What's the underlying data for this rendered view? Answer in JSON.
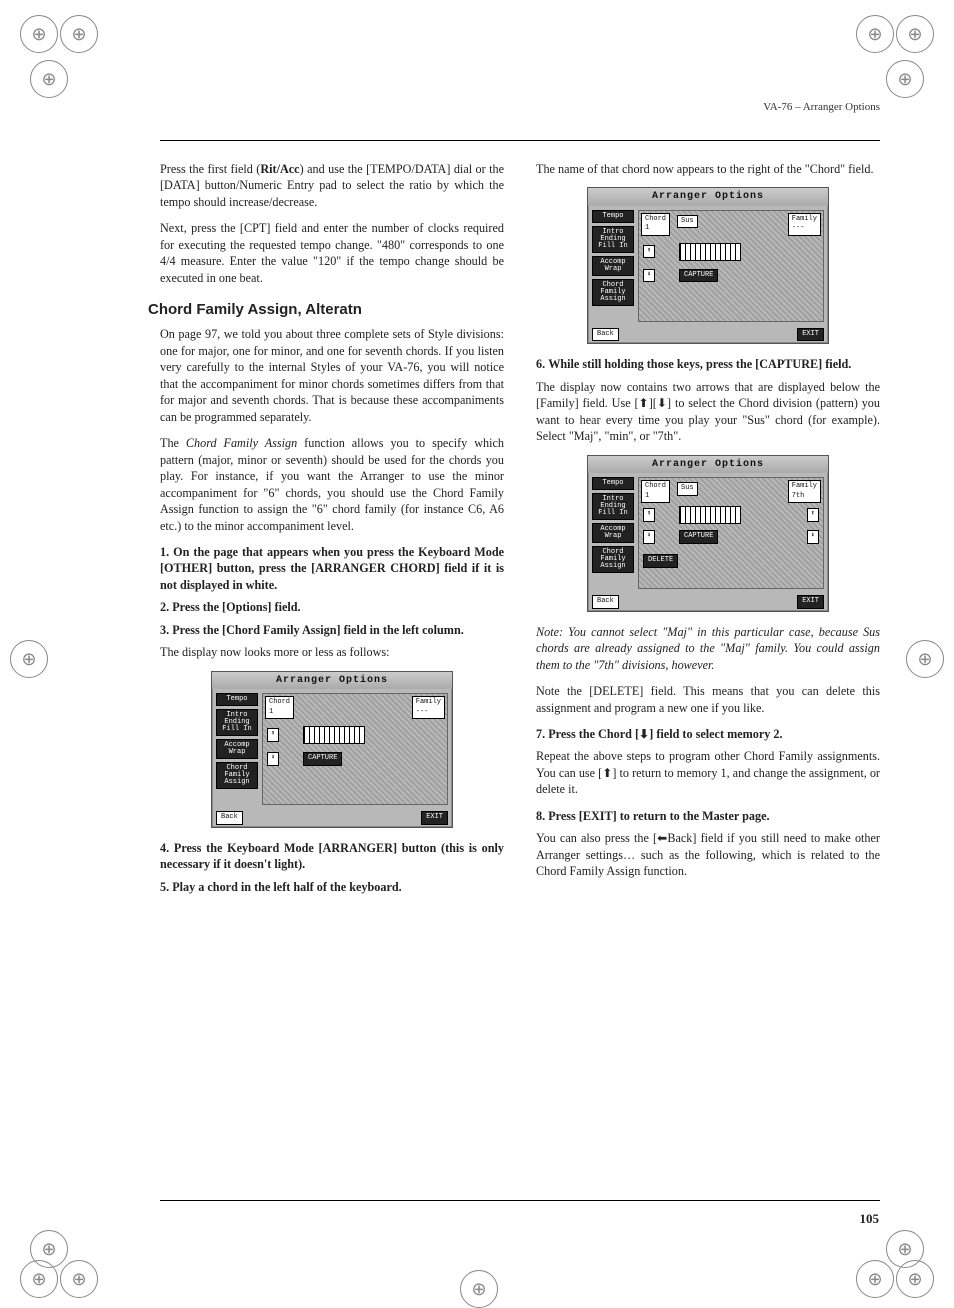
{
  "header": "VA-76 – Arranger Options",
  "pageNumber": "105",
  "left": {
    "p1": "Press the first field (Rit/Acc) and use the [TEMPO/DATA] dial or the [DATA] button/Numeric Entry pad to select the ratio by which the tempo should increase/decrease.",
    "p2": "Next, press the [CPT] field and enter the number of clocks required for executing the requested tempo change. \"480\" corresponds to one 4/4 measure. Enter the value \"120\" if the tempo change should be executed in one beat.",
    "secTitle": "Chord Family Assign, Alteratn",
    "p3": "On page 97, we told you about three complete sets of Style divisions: one for major, one for minor, and one for seventh chords. If you listen very carefully to the internal Styles of your VA-76, you will notice that the accompaniment for minor chords sometimes differs from that for major and seventh chords. That is because these accompaniments can be programmed separately.",
    "p4": "The Chord Family Assign function allows you to specify which pattern (major, minor or seventh) should be used for the chords you play. For instance, if you want the Arranger to use the minor accompaniment for \"6\" chords, you should use the Chord Family Assign function to assign the \"6\" chord family (for instance C6, A6 etc.) to the minor accompaniment level.",
    "s1n": "1.",
    "s1": "On the page that appears when you press the Keyboard Mode [OTHER] button, press the [ARRANGER CHORD] field if it is not displayed in white.",
    "s2n": "2.",
    "s2": "Press the [Options] field.",
    "s3n": "3.",
    "s3": "Press the [Chord Family Assign] field in the left column.",
    "p5": "The display now looks more or less as follows:",
    "s4n": "4.",
    "s4": "Press the Keyboard Mode [ARRANGER] button (this is only necessary if it doesn't light).",
    "s5n": "5.",
    "s5": "Play a chord in the left half of the keyboard."
  },
  "right": {
    "p1": "The name of that chord now appears to the right of the \"Chord\" field.",
    "s6n": "6.",
    "s6": "While still holding those keys, press the [CAPTURE] field.",
    "p2": "The display now contains two arrows that are displayed below the [Family] field. Use [⬆][⬇] to select the Chord division (pattern) you want to hear every time you play your \"Sus\" chord (for example). Select \"Maj\", \"min\", or \"7th\".",
    "note": "Note: You cannot select \"Maj\" in this particular case, because Sus chords are already assigned to the \"Maj\" family. You could assign them to the \"7th\" divisions, however.",
    "p3": "Note the [DELETE] field. This means that you can delete this assignment and program a new one if you like.",
    "s7n": "7.",
    "s7": "Press the Chord [⬇] field to select memory 2.",
    "p4": "Repeat the above steps to program other Chord Family assignments. You can use [⬆] to return to memory 1, and change the assignment, or delete it.",
    "s8n": "8.",
    "s8": "Press [EXIT] to return to the Master page.",
    "p5": "You can also press the [⬅Back] field if you still need to make other Arranger settings… such as the following, which is related to the Chord Family Assign function."
  },
  "lcd": {
    "title": "Arranger Options",
    "side": [
      "Tempo",
      "Intro\nEnding\nFill In",
      "Accomp\nWrap",
      "Chord\nFamily\nAssign"
    ],
    "chord": "Chord",
    "chordNum1": "1",
    "sus": "Sus",
    "family": "Family",
    "familyDash": "---",
    "family7th": "7th",
    "capture": "CAPTURE",
    "delete": "DELETE",
    "back": "Back",
    "exit": "EXIT"
  }
}
